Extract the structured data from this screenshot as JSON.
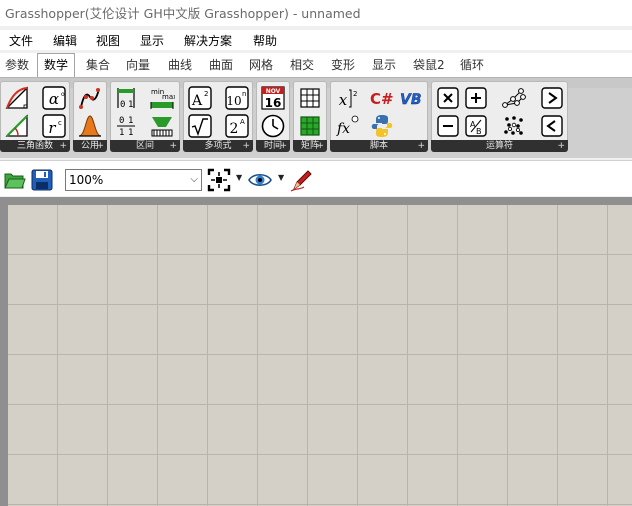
{
  "window": {
    "title": "Grasshopper(艾伦设计 GH中文版 Grasshopper) - unnamed"
  },
  "menu": [
    "文件",
    "编辑",
    "视图",
    "显示",
    "解决方案",
    "帮助"
  ],
  "tabs": [
    "参数",
    "数学",
    "集合",
    "向量",
    "曲线",
    "曲面",
    "网格",
    "相交",
    "变形",
    "显示",
    "袋鼠2",
    "循环"
  ],
  "active_tab": "数学",
  "panels": [
    {
      "label": "三角函数",
      "icons": [
        "triangle-curve-icon",
        "alpha-icon",
        "triangle-right-icon",
        "r-squared-icon"
      ]
    },
    {
      "label": "公用",
      "icons": [
        "sine-dots-icon",
        "bell-curve-icon"
      ]
    },
    {
      "label": "区间",
      "icons": [
        "interval-domain-icon",
        "min-max-icon",
        "interval-list-icon",
        "gradient-bar-icon"
      ]
    },
    {
      "label": "多项式",
      "icons": [
        "a-squared-icon",
        "power-ten-icon",
        "square-root-icon",
        "two-power-icon"
      ]
    },
    {
      "label": "时间",
      "icons": [
        "calendar-icon",
        "clock-icon"
      ]
    },
    {
      "label": "矩阵",
      "icons": [
        "matrix-grid-icon",
        "green-matrix-icon"
      ]
    },
    {
      "label": "脚本",
      "icons": [
        "x-squared-icon",
        "csharp-icon",
        "vb-icon",
        "fx-icon",
        "python-icon"
      ]
    },
    {
      "label": "运算符",
      "icons": [
        "multiply-icon",
        "add-icon",
        "graph-nodes-icon",
        "greater-than-icon",
        "subtract-icon",
        "divide-icon",
        "dots-cluster-icon",
        "less-than-icon"
      ]
    }
  ],
  "calendar": {
    "month": "NOV",
    "day": "16"
  },
  "script_text": {
    "csharp": "C#",
    "vb": "VB",
    "fx": "fx"
  },
  "zoom": {
    "value": "100%"
  },
  "toolbar_icons": [
    "open-folder-icon",
    "save-icon",
    "zoom-extents-icon",
    "eye-icon",
    "sketch-pen-icon"
  ],
  "colors": {
    "canvas": "#d4d0c8",
    "grid": "#b8b4ad",
    "panel_label": "#303030",
    "ribbon": "#cfcfcf"
  }
}
